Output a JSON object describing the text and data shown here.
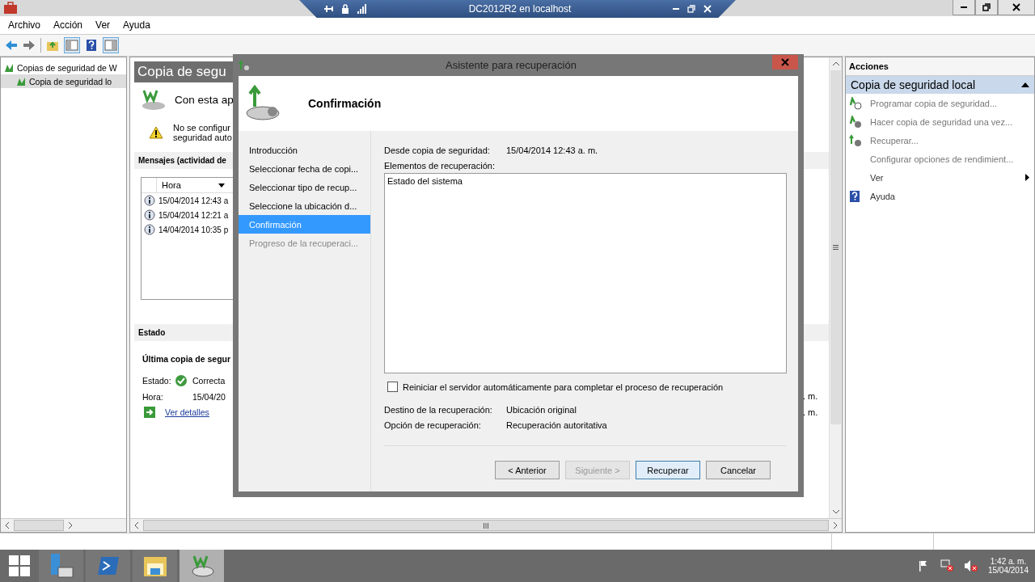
{
  "rdp_bar": {
    "host": "DC2012R2 en localhost"
  },
  "menu": [
    "Archivo",
    "Acción",
    "Ver",
    "Ayuda"
  ],
  "tree": [
    {
      "label": "Copias de seguridad de W",
      "selected": false,
      "children": [
        {
          "label": "Copia de seguridad lo",
          "selected": true
        }
      ]
    }
  ],
  "center": {
    "title": "Copia de segu",
    "intro": "Con esta ap",
    "warning": [
      "No se configur",
      "seguridad auto"
    ],
    "messages": {
      "heading": "Mensajes (actividad de",
      "column": "Hora",
      "rows": [
        "15/04/2014 12:43 a",
        "15/04/2014 12:21 a",
        "14/04/2014 10:35 p"
      ]
    },
    "status": {
      "heading": "Estado",
      "subheading": "Última copia de segur",
      "fields": [
        {
          "label": "Estado:",
          "value": "Correcta",
          "kind": "ok"
        },
        {
          "label": "Hora:",
          "value": "15/04/20",
          "kind": "plain"
        }
      ],
      "link": "Ver detalles"
    },
    "right_fragments": [
      ". m.",
      ". m."
    ]
  },
  "dialog": {
    "title": "Asistente para recuperación",
    "heading": "Confirmación",
    "steps": [
      {
        "label": "Introducción",
        "selected": false,
        "disabled": false
      },
      {
        "label": "Seleccionar fecha de copi...",
        "selected": false,
        "disabled": false
      },
      {
        "label": "Seleccionar tipo de recup...",
        "selected": false,
        "disabled": false
      },
      {
        "label": "Seleccione la ubicación d...",
        "selected": false,
        "disabled": false
      },
      {
        "label": "Confirmación",
        "selected": true,
        "disabled": false
      },
      {
        "label": "Progreso de la recuperaci...",
        "selected": false,
        "disabled": true
      }
    ],
    "source": {
      "label": "Desde copia de seguridad:",
      "value": "15/04/2014 12:43 a. m."
    },
    "items_label": "Elementos de recuperación:",
    "items": [
      "Estado del sistema"
    ],
    "restart": {
      "label": "Reiniciar el servidor automáticamente para completar el proceso de recuperación",
      "checked": false
    },
    "details": [
      {
        "label": "Destino de la recuperación:",
        "value": "Ubicación original"
      },
      {
        "label": "Opción de recuperación:",
        "value": "Recuperación autoritativa"
      }
    ],
    "buttons": [
      {
        "label": "< Anterior",
        "disabled": false,
        "default": false
      },
      {
        "label": "Siguiente >",
        "disabled": true,
        "default": false
      },
      {
        "label": "Recuperar",
        "disabled": false,
        "default": true
      },
      {
        "label": "Cancelar",
        "disabled": false,
        "default": false
      }
    ]
  },
  "actions": {
    "heading": "Acciones",
    "section": {
      "label": "Copia de seguridad local",
      "expanded": true
    },
    "items": [
      {
        "label": "Programar copia de seguridad...",
        "kind": "schedule",
        "disabled": true
      },
      {
        "label": "Hacer copia de seguridad una vez...",
        "kind": "backup",
        "disabled": true
      },
      {
        "label": "Recuperar...",
        "kind": "restore",
        "disabled": true
      },
      {
        "label": "Configurar opciones de rendimient...",
        "kind": "none",
        "disabled": true
      },
      {
        "label": "Ver",
        "kind": "submenu",
        "disabled": false
      },
      {
        "label": "Ayuda",
        "kind": "help",
        "disabled": false
      }
    ]
  },
  "taskbar": {
    "apps": [
      {
        "kind": "server",
        "selected": false
      },
      {
        "kind": "shell",
        "selected": false
      },
      {
        "kind": "folder",
        "selected": false
      },
      {
        "kind": "backup",
        "selected": true
      }
    ],
    "clock": {
      "time": "1:42 a. m.",
      "date": "15/04/2014"
    }
  }
}
